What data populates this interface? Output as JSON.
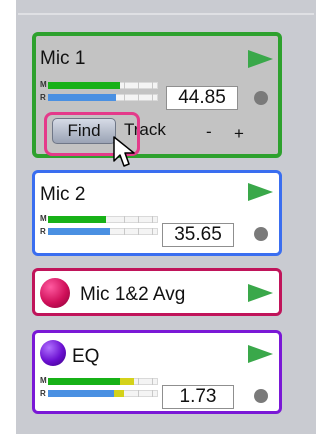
{
  "colors": {
    "panel_bg": "#c9cbd1",
    "play_green": "#3aa84a",
    "meter_green": "#17b117",
    "meter_blue": "#4a90e2",
    "meter_yellow": "#d4d21a",
    "mic1_border": "#2ea12e",
    "mic2_border": "#3a6ef0",
    "avg_border": "#c0145a",
    "eq_border": "#7a18d6",
    "highlight": "#e43a8a"
  },
  "cards": [
    {
      "title": "Mic 1",
      "value": "44.85",
      "selected": true,
      "meters": [
        {
          "label": "M",
          "level": 0.82,
          "color": "green"
        },
        {
          "label": "R",
          "level": 0.78,
          "color": "blue"
        }
      ],
      "controls": {
        "find": "Find",
        "track": "Track",
        "minus": "-",
        "plus": "+"
      }
    },
    {
      "title": "Mic 2",
      "value": "35.65",
      "meters": [
        {
          "label": "M",
          "level": 0.55,
          "color": "green"
        },
        {
          "label": "R",
          "level": 0.58,
          "color": "blue"
        }
      ]
    },
    {
      "title": "Mic 1&2 Avg",
      "ball_color": "#d0105a"
    },
    {
      "title": "EQ",
      "value": "1.73",
      "ball_color": "#6a0fd0",
      "meters": [
        {
          "label": "M",
          "level": 0.65,
          "color": "green",
          "peak": 0.78
        },
        {
          "label": "R",
          "level": 0.6,
          "color": "blue",
          "peak": 0.68
        }
      ]
    }
  ],
  "icons": {
    "play": "play-triangle-icon",
    "status": "status-dot-icon",
    "cursor": "mouse-pointer-icon"
  }
}
